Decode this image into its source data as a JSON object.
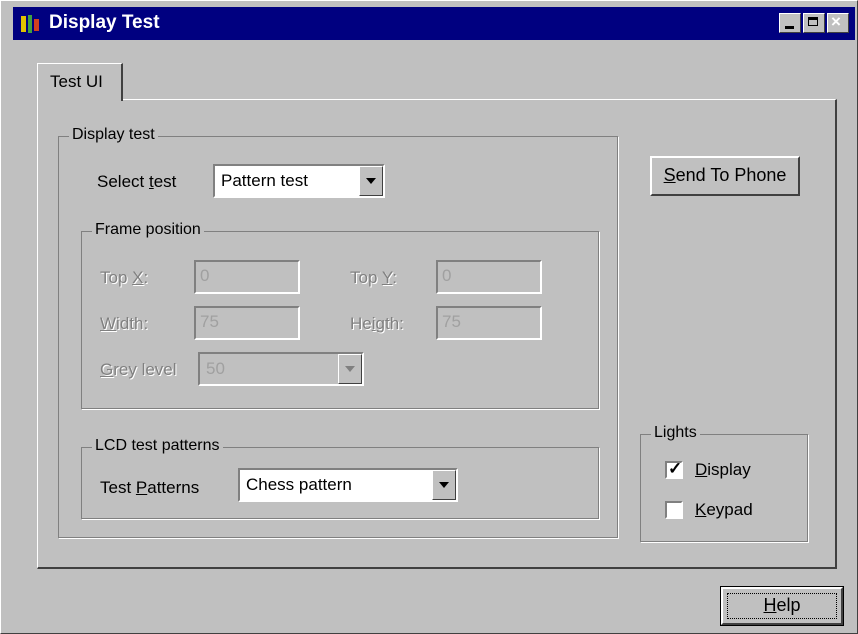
{
  "window": {
    "title": "Display Test"
  },
  "tabs": [
    {
      "label": "Test UI"
    }
  ],
  "display_test": {
    "group_label": "Display test",
    "select_test": {
      "label_pre": "Select ",
      "label_u": "t",
      "label_post": "est",
      "value": "Pattern test"
    },
    "frame_position": {
      "group_label": "Frame position",
      "top_x": {
        "label_pre": "Top ",
        "label_u": "X",
        "label_post": ":",
        "value": "0"
      },
      "top_y": {
        "label_pre": "Top ",
        "label_u": "Y",
        "label_post": ":",
        "value": "0"
      },
      "width": {
        "label_pre": "",
        "label_u": "W",
        "label_post": "idth:",
        "value": "75"
      },
      "heigth": {
        "label_pre": "He",
        "label_u": "i",
        "label_post": "gth:",
        "value": "75"
      },
      "grey_level": {
        "label_pre": "",
        "label_u": "G",
        "label_post": "rey level",
        "value": "50"
      }
    },
    "lcd": {
      "group_label": "LCD test patterns",
      "test_patterns": {
        "label_pre": "Test ",
        "label_u": "P",
        "label_post": "atterns",
        "value": "Chess pattern"
      }
    }
  },
  "send_button": {
    "label_u": "S",
    "label_post": "end To Phone"
  },
  "lights": {
    "group_label": "Lights",
    "display": {
      "label_u": "D",
      "label_post": "isplay",
      "checked": true
    },
    "keypad": {
      "label_u": "K",
      "label_post": "eypad",
      "checked": false
    }
  },
  "help_button": {
    "label_u": "H",
    "label_post": "elp"
  }
}
